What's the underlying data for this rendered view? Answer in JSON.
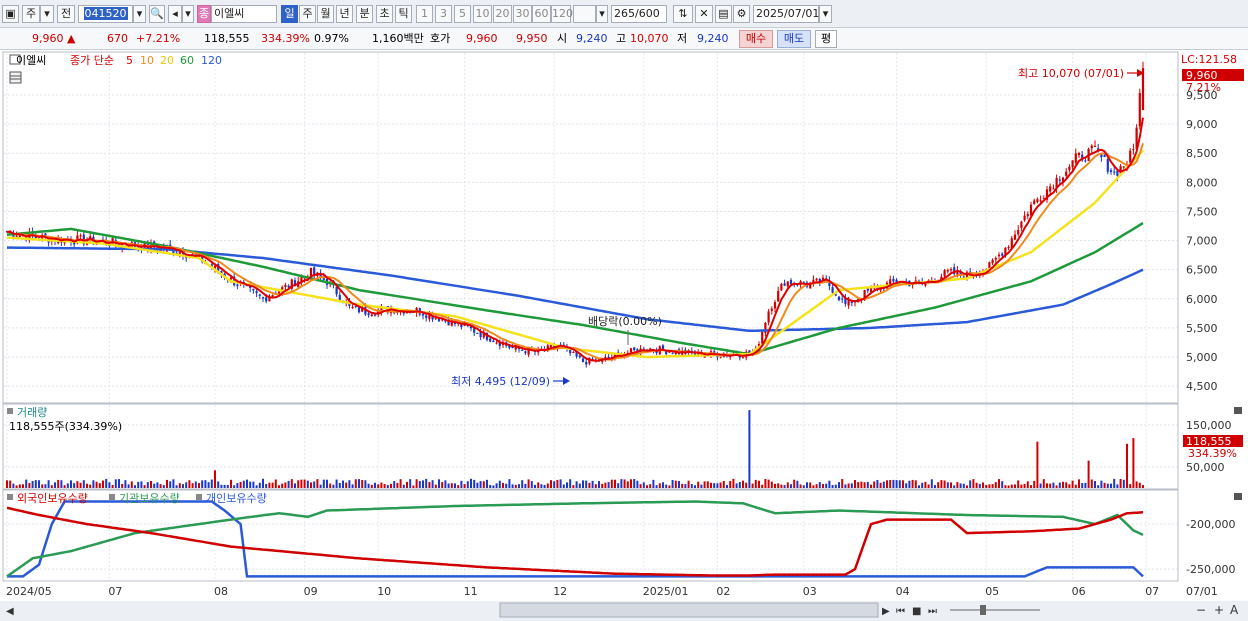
{
  "toolbar": {
    "mode_options": [
      "주"
    ],
    "prev_label": "전",
    "stock_code": "041520",
    "stock_name": "이엘씨",
    "stock_badge": "종",
    "periods": [
      "일",
      "주",
      "월",
      "년",
      "분",
      "초",
      "틱"
    ],
    "active_period": "일",
    "intervals": [
      "1",
      "3",
      "5",
      "10",
      "20",
      "30",
      "60",
      "120"
    ],
    "view_count": "265",
    "view_total": "/600",
    "date": "2025/07/01"
  },
  "quote": {
    "price": "9,960",
    "change_arrow": "▲",
    "change": "670",
    "change_pct": "+7.21%",
    "volume": "118,555",
    "volume_ratio": "334.39%",
    "turnover": "0.97%",
    "amount": "1,160백만",
    "hoga_label": "호가",
    "ask": "9,960",
    "bid": "9,950",
    "open_label": "시",
    "open": "9,240",
    "high_label": "고",
    "high": "10,070",
    "low_label": "저",
    "low": "9,240",
    "buy_label": "매수",
    "sell_label": "매도",
    "eval_label": "평"
  },
  "colors": {
    "up": "#d10000",
    "down": "#1a37c8",
    "ma5": "#e00000",
    "ma10": "#f08a1e",
    "ma20": "#f5e21b",
    "ma60": "#1f9a3a",
    "ma120": "#2a5ad8",
    "foreign": "#d00000",
    "institution": "#2a9a55",
    "individual": "#2a5ad8"
  },
  "price_panel": {
    "name": "이엘씨",
    "ma_label": "종가 단순",
    "ma_periods": [
      "5",
      "10",
      "20",
      "60",
      "120"
    ],
    "lc_label": "LC:121.58",
    "current_price": "9,960",
    "current_pct": "7.21%",
    "y_ticks": [
      "9,500",
      "9,000",
      "8,500",
      "8,000",
      "7,500",
      "7,000",
      "6,500",
      "6,000",
      "5,500",
      "5,000",
      "4,500"
    ],
    "high_annotation": "최고 10,070 (07/01)",
    "low_annotation": "최저 4,495 (12/09)",
    "dividend_annotation": "배당락(0.00%)"
  },
  "volume_panel": {
    "label": "거래량",
    "current": "118,555주(334.39%)",
    "y_ticks": [
      "150,000",
      "50,000"
    ],
    "current_value": "118,555",
    "current_pct": "334.39%"
  },
  "holdings_panel": {
    "labels": [
      "외국인보유수량",
      "기관보유수량",
      "개인보유수량"
    ],
    "y_ticks": [
      "-200,000",
      "-250,000"
    ]
  },
  "x_axis": {
    "labels": [
      "2024/05",
      "07",
      "08",
      "09",
      "10",
      "11",
      "12",
      "2025/01",
      "02",
      "03",
      "04",
      "05",
      "06",
      "07"
    ],
    "right_label": "07/01"
  },
  "chart_data": {
    "type": "candlestick",
    "y_range": [
      4400,
      10100
    ],
    "price_points": [
      [
        0,
        7150
      ],
      [
        10,
        7050
      ],
      [
        25,
        7000
      ],
      [
        40,
        6920
      ],
      [
        52,
        6850
      ],
      [
        60,
        6700
      ],
      [
        68,
        6400
      ],
      [
        75,
        6150
      ],
      [
        80,
        6000
      ],
      [
        87,
        6200
      ],
      [
        95,
        6450
      ],
      [
        100,
        6300
      ],
      [
        104,
        6050
      ],
      [
        107,
        5850
      ],
      [
        112,
        5780
      ],
      [
        120,
        5820
      ],
      [
        128,
        5800
      ],
      [
        136,
        5650
      ],
      [
        144,
        5500
      ],
      [
        150,
        5350
      ],
      [
        158,
        5150
      ],
      [
        166,
        5080
      ],
      [
        172,
        5200
      ],
      [
        180,
        4920
      ],
      [
        186,
        4950
      ],
      [
        192,
        5050
      ],
      [
        200,
        5150
      ],
      [
        208,
        5100
      ],
      [
        216,
        5050
      ],
      [
        224,
        5050
      ],
      [
        230,
        5050
      ],
      [
        234,
        5100
      ],
      [
        238,
        5800
      ],
      [
        243,
        6300
      ],
      [
        250,
        6250
      ],
      [
        256,
        6300
      ],
      [
        262,
        5900
      ],
      [
        270,
        6150
      ],
      [
        278,
        6300
      ],
      [
        286,
        6250
      ],
      [
        294,
        6450
      ],
      [
        300,
        6400
      ],
      [
        307,
        6550
      ],
      [
        313,
        6950
      ],
      [
        320,
        7600
      ],
      [
        328,
        8050
      ],
      [
        334,
        8400
      ],
      [
        340,
        8550
      ],
      [
        346,
        8150
      ],
      [
        350,
        8350
      ],
      [
        352,
        8550
      ],
      [
        355,
        9960
      ]
    ],
    "ma20_points": [
      [
        0,
        7050
      ],
      [
        30,
        6950
      ],
      [
        60,
        6700
      ],
      [
        70,
        6300
      ],
      [
        95,
        6050
      ],
      [
        110,
        5900
      ],
      [
        140,
        5700
      ],
      [
        175,
        5150
      ],
      [
        200,
        5000
      ],
      [
        232,
        5050
      ],
      [
        260,
        6150
      ],
      [
        300,
        6350
      ],
      [
        320,
        6800
      ],
      [
        340,
        7650
      ],
      [
        355,
        8550
      ]
    ],
    "ma60_points": [
      [
        0,
        7100
      ],
      [
        20,
        7200
      ],
      [
        50,
        6900
      ],
      [
        80,
        6550
      ],
      [
        110,
        6150
      ],
      [
        150,
        5800
      ],
      [
        180,
        5550
      ],
      [
        210,
        5250
      ],
      [
        232,
        5050
      ],
      [
        260,
        5500
      ],
      [
        290,
        5850
      ],
      [
        320,
        6300
      ],
      [
        340,
        6800
      ],
      [
        355,
        7300
      ]
    ],
    "ma120_points": [
      [
        0,
        6880
      ],
      [
        50,
        6850
      ],
      [
        80,
        6700
      ],
      [
        120,
        6400
      ],
      [
        160,
        6050
      ],
      [
        200,
        5650
      ],
      [
        232,
        5450
      ],
      [
        270,
        5500
      ],
      [
        300,
        5600
      ],
      [
        330,
        5900
      ],
      [
        345,
        6250
      ],
      [
        355,
        6500
      ]
    ],
    "volume_range": [
      0,
      190000
    ],
    "volume_spikes": [
      [
        65,
        42000
      ],
      [
        232,
        185000
      ],
      [
        322,
        110000
      ],
      [
        338,
        65000
      ],
      [
        352,
        118555
      ],
      [
        350,
        105000
      ]
    ],
    "y_range_holdings": [
      -262000,
      -170000
    ],
    "foreign_points": [
      [
        0,
        -182000
      ],
      [
        10,
        -190000
      ],
      [
        25,
        -200000
      ],
      [
        45,
        -210000
      ],
      [
        70,
        -225000
      ],
      [
        110,
        -238000
      ],
      [
        150,
        -248000
      ],
      [
        190,
        -255000
      ],
      [
        220,
        -257000
      ],
      [
        232,
        -257000
      ],
      [
        240,
        -256000
      ],
      [
        262,
        -256000
      ],
      [
        265,
        -250000
      ],
      [
        270,
        -200000
      ],
      [
        275,
        -195000
      ],
      [
        295,
        -195000
      ],
      [
        300,
        -210000
      ],
      [
        320,
        -208000
      ],
      [
        335,
        -205000
      ],
      [
        345,
        -195000
      ],
      [
        350,
        -188000
      ],
      [
        355,
        -187000
      ]
    ],
    "institution_points": [
      [
        0,
        -258000
      ],
      [
        8,
        -238000
      ],
      [
        20,
        -230000
      ],
      [
        40,
        -210000
      ],
      [
        70,
        -195000
      ],
      [
        85,
        -188000
      ],
      [
        94,
        -192000
      ],
      [
        100,
        -185000
      ],
      [
        140,
        -180000
      ],
      [
        180,
        -177000
      ],
      [
        215,
        -175000
      ],
      [
        230,
        -177000
      ],
      [
        240,
        -188000
      ],
      [
        260,
        -185000
      ],
      [
        300,
        -190000
      ],
      [
        330,
        -192000
      ],
      [
        340,
        -200000
      ],
      [
        347,
        -190000
      ],
      [
        352,
        -207000
      ],
      [
        355,
        -212000
      ]
    ],
    "individual_points": [
      [
        0,
        -258000
      ],
      [
        5,
        -258000
      ],
      [
        10,
        -245000
      ],
      [
        14,
        -200000
      ],
      [
        18,
        -175000
      ],
      [
        64,
        -175000
      ],
      [
        68,
        -185000
      ],
      [
        73,
        -200000
      ],
      [
        75,
        -258000
      ],
      [
        200,
        -258000
      ],
      [
        318,
        -258000
      ],
      [
        325,
        -248000
      ],
      [
        352,
        -248000
      ],
      [
        355,
        -258000
      ]
    ]
  }
}
